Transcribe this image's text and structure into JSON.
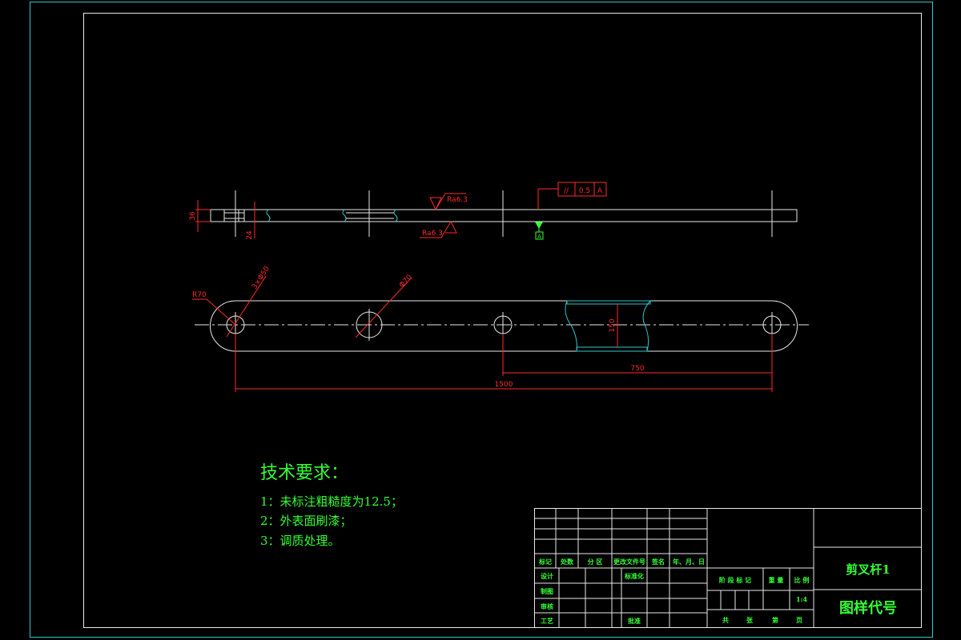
{
  "dimensions": {
    "thickness_36": "36",
    "slot_24": "24",
    "roughness_top": "Ra6.3",
    "roughness_bottom": "Ra6.3",
    "parallelism_symbol": "//",
    "parallelism_value": "0.5",
    "datum_ref": "A",
    "datum_label": "A",
    "radius_end": "R70",
    "holes": "3×Φ50",
    "bore_dia": "Φ70",
    "height_150": "150",
    "span_750": "750",
    "span_1500": "1500"
  },
  "tech_requirements": {
    "title": "技术要求：",
    "items": [
      "1：未标注粗糙度为12.5；",
      "2：外表面刷漆；",
      "3：调质处理。"
    ]
  },
  "title_block": {
    "header_cells": [
      "标记",
      "处数",
      "分 区",
      "更改文件号",
      "签名",
      "年、月、日"
    ],
    "row_labels": [
      "设计",
      "制图",
      "审核",
      "工艺"
    ],
    "standardize": "标准化",
    "approve": "批准",
    "stage_headers": [
      "阶 段 标 记",
      "重 量",
      "比 例"
    ],
    "scale": "1:4",
    "sheet_footer": [
      "共",
      "张",
      "第",
      "页"
    ],
    "part_name": "剪叉杆1",
    "drawing_number": "图样代号"
  }
}
